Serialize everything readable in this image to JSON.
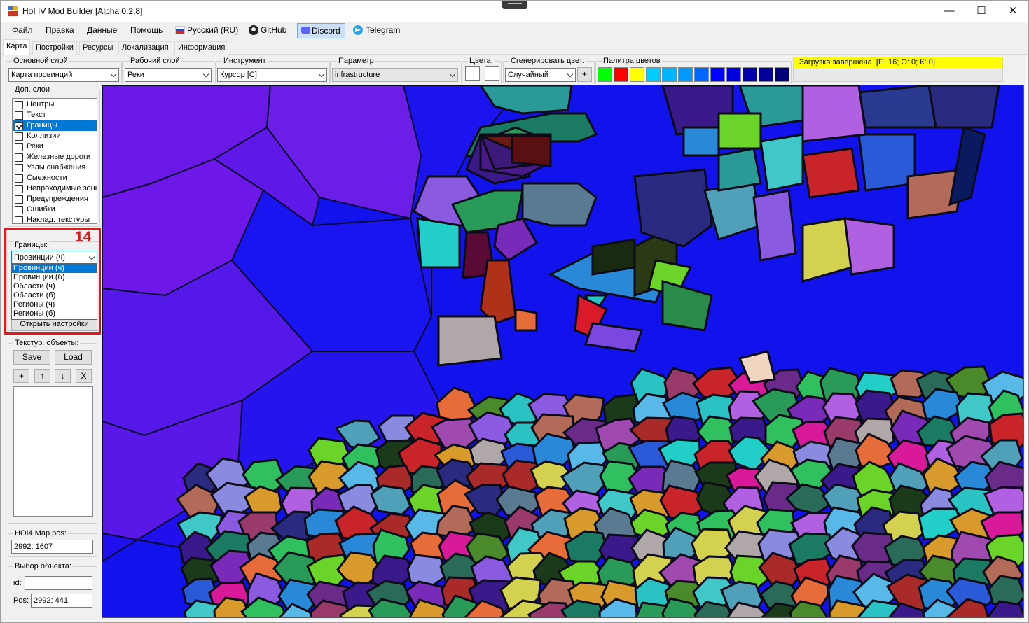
{
  "window": {
    "title": "HoI IV Mod Builder [Alpha 0.2.8]",
    "minimize": "—",
    "maximize": "☐",
    "close": "✕"
  },
  "menu": {
    "file": "Файл",
    "edit": "Правка",
    "data": "Данные",
    "help": "Помощь",
    "language": "Русский (RU)",
    "github": "GitHub",
    "discord": "Discord",
    "telegram": "Telegram"
  },
  "tabs": [
    "Карта",
    "Постройки",
    "Ресурсы",
    "Локализация",
    "Информация"
  ],
  "toolbar": {
    "main_layer": {
      "label": "Основной слой",
      "value": "Карта провинций"
    },
    "work_layer": {
      "label": "Рабочий слой",
      "value": "Реки"
    },
    "tool": {
      "label": "Инструмент",
      "value": "Курсор [C]"
    },
    "parameter": {
      "label": "Параметр",
      "value": "infrastructure"
    },
    "colors": {
      "label": "Цвета:"
    },
    "generate_color": {
      "label": "Сгенерировать цвет:",
      "value": "Случайный",
      "add_button": "+"
    },
    "palette": {
      "label": "Палитра цветов",
      "colors": [
        "#00ff00",
        "#ff0000",
        "#ffff00",
        "#00ccff",
        "#00b4ff",
        "#0099ff",
        "#0066ff",
        "#0000ff",
        "#0000dd",
        "#0000aa",
        "#000099",
        "#00007a"
      ]
    },
    "status": "Загрузка завершена. [П: 16; О: 0; К: 0]"
  },
  "layers": {
    "title": "Доп. слои",
    "items": [
      {
        "label": "Центры",
        "checked": false
      },
      {
        "label": "Текст",
        "checked": false
      },
      {
        "label": "Границы",
        "checked": true
      },
      {
        "label": "Коллизии",
        "checked": false
      },
      {
        "label": "Реки",
        "checked": false
      },
      {
        "label": "Железные дороги",
        "checked": false
      },
      {
        "label": "Узлы снабжения",
        "checked": false
      },
      {
        "label": "Смежности",
        "checked": false
      },
      {
        "label": "Непроходимые зоны",
        "checked": false
      },
      {
        "label": "Предупреждения",
        "checked": false
      },
      {
        "label": "Ошибки",
        "checked": false
      },
      {
        "label": "Наклад. текстуры",
        "checked": false
      }
    ]
  },
  "borders": {
    "annotation": "14",
    "label": "Границы:",
    "value": "Провинции (ч)",
    "options": [
      "Провинции (ч)",
      "Провинции (б)",
      "Области (ч)",
      "Области (б)",
      "Регионы (ч)",
      "Регионы (б)"
    ],
    "open_settings": "Открыть настройки"
  },
  "textures": {
    "label": "Текстур. объекты:",
    "save": "Save",
    "load": "Load",
    "add": "+",
    "up": "↑",
    "down": "↓",
    "remove": "X"
  },
  "map_pos": {
    "label": "HOI4 Map pos:",
    "value": "2992; 1607"
  },
  "object_select": {
    "label": "Выбор объекта:",
    "id_label": "id:",
    "id_value": "",
    "pos_label": "Pos:",
    "pos_value": "2992; 441"
  }
}
